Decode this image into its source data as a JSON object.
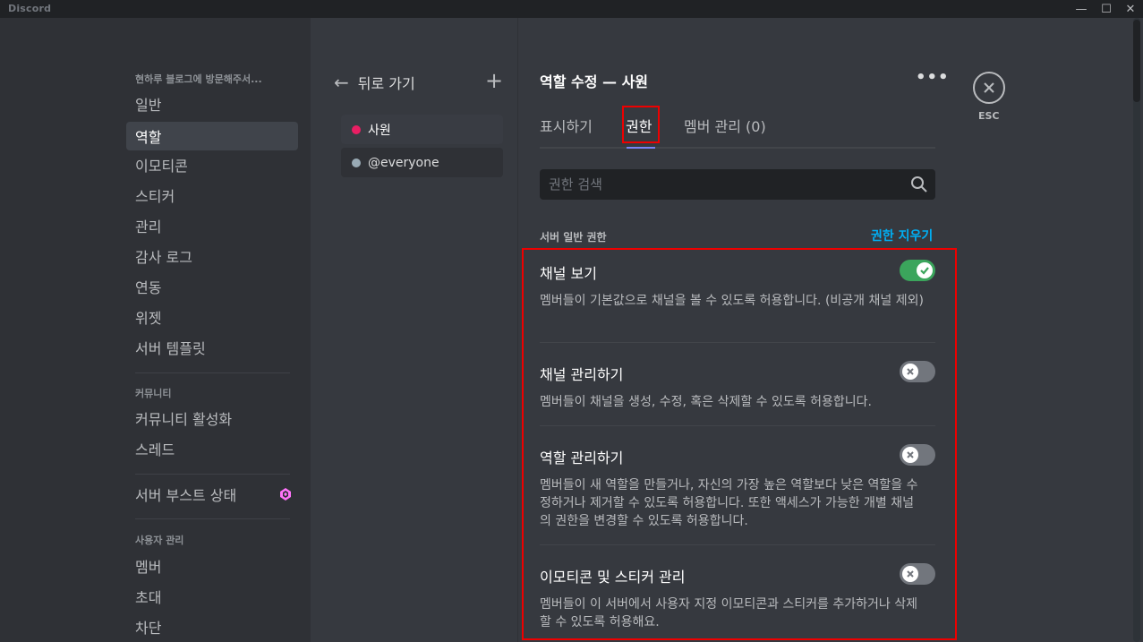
{
  "window": {
    "brand": "Discord",
    "minimize": "—",
    "maximize": "☐",
    "close": "✕"
  },
  "sidebar": {
    "server_header": "현하루 블로그에 방문해주서...",
    "items": [
      "일반",
      "역할",
      "이모티콘",
      "스티커",
      "관리",
      "감사 로그",
      "연동",
      "위젯",
      "서버 템플릿"
    ],
    "community_header": "커뮤니티",
    "community_items": [
      "커뮤니티 활성화",
      "스레드"
    ],
    "boost": "서버 부스트 상태",
    "user_header": "사용자 관리",
    "user_items": [
      "멤버",
      "초대",
      "차단"
    ],
    "boost_color": "#ff73fa"
  },
  "roles_panel": {
    "back": "뒤로 가기",
    "roles": [
      {
        "name": "사원",
        "color": "#e91e63"
      },
      {
        "name": "@everyone",
        "color": "#99aab5"
      }
    ]
  },
  "editor": {
    "title": "역할 수정 — 사원",
    "tabs": [
      "표시하기",
      "권한",
      "멤버 관리 (0)"
    ],
    "search_placeholder": "권한 검색",
    "section_title": "서버 일반 권한",
    "clear_label": "권한 지우기",
    "permissions": [
      {
        "title": "채널 보기",
        "desc": "멤버들이 기본값으로 채널을 볼 수 있도록 허용합니다. (비공개 채널 제외)",
        "enabled": true
      },
      {
        "title": "채널 관리하기",
        "desc": "멤버들이 채널을 생성, 수정, 혹은 삭제할 수 있도록 허용합니다.",
        "enabled": false
      },
      {
        "title": "역할 관리하기",
        "desc": "멤버들이 새 역할을 만들거나, 자신의 가장 높은 역할보다 낮은 역할을 수정하거나 제거할 수 있도록 허용합니다. 또한 액세스가 가능한 개별 채널의 권한을 변경할 수 있도록 허용합니다.",
        "enabled": false
      },
      {
        "title": "이모티콘 및 스티커 관리",
        "desc": "멤버들이 이 서버에서 사용자 지정 이모티콘과 스티커를 추가하거나 삭제할 수 있도록 허용해요.",
        "enabled": false
      }
    ],
    "esc_label": "ESC"
  }
}
